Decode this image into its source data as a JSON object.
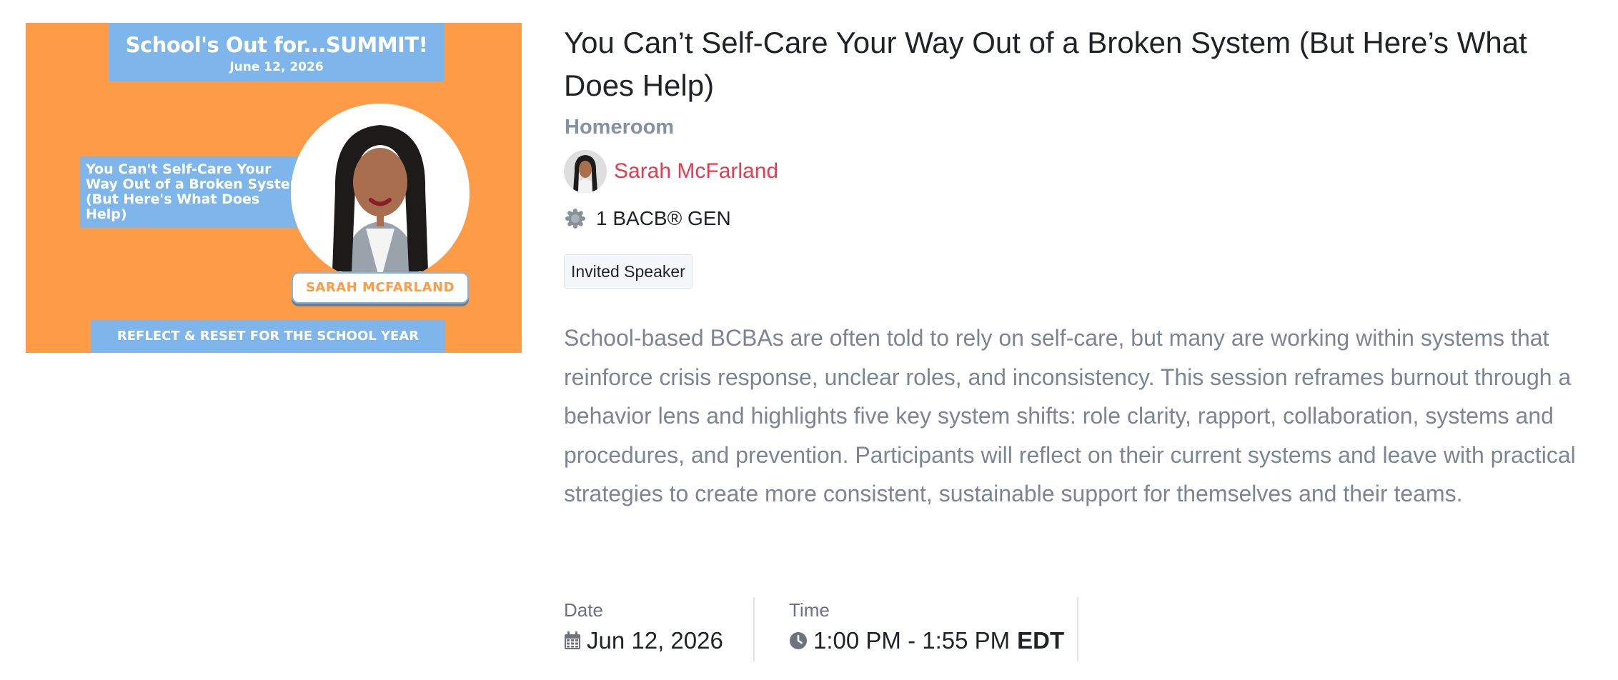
{
  "banner": {
    "summit_title": "School's Out for...SUMMIT!",
    "summit_date": "June 12, 2026",
    "session_title": "You Can't Self-Care Your Way Out of a Broken System (But Here's What Does Help)",
    "speaker_tag": "SARAH MCFARLAND",
    "footer": "REFLECT & RESET FOR THE SCHOOL YEAR"
  },
  "session": {
    "title": "You Can’t Self-Care Your Way Out of a Broken System (But Here’s What Does Help)",
    "track": "Homeroom",
    "speaker_name": "Sarah McFarland",
    "credit": "1 BACB® GEN",
    "tag": "Invited Speaker",
    "description": "School-based BCBAs are often told to rely on self-care, but many are working within systems that reinforce crisis response, unclear roles, and inconsistency. This session reframes burnout through a behavior lens and highlights five key system shifts: role clarity, rapport, collaboration, systems and procedures, and prevention. Participants will reflect on their current systems and leave with practical strategies to create more consistent, sustainable support for themselves and their teams."
  },
  "meta": {
    "date_label": "Date",
    "date_value": "Jun 12, 2026",
    "time_label": "Time",
    "time_value": "1:00 PM - 1:55 PM",
    "timezone": "EDT"
  },
  "icons": {
    "date": "calendar-icon",
    "time": "clock-icon",
    "credit": "seal-icon"
  },
  "colors": {
    "banner_orange": "#fd9b47",
    "banner_blue": "#7eb6ec",
    "speaker_link": "#e13d4f",
    "track_gray": "#8592a3",
    "description_gray": "#7c8592"
  }
}
